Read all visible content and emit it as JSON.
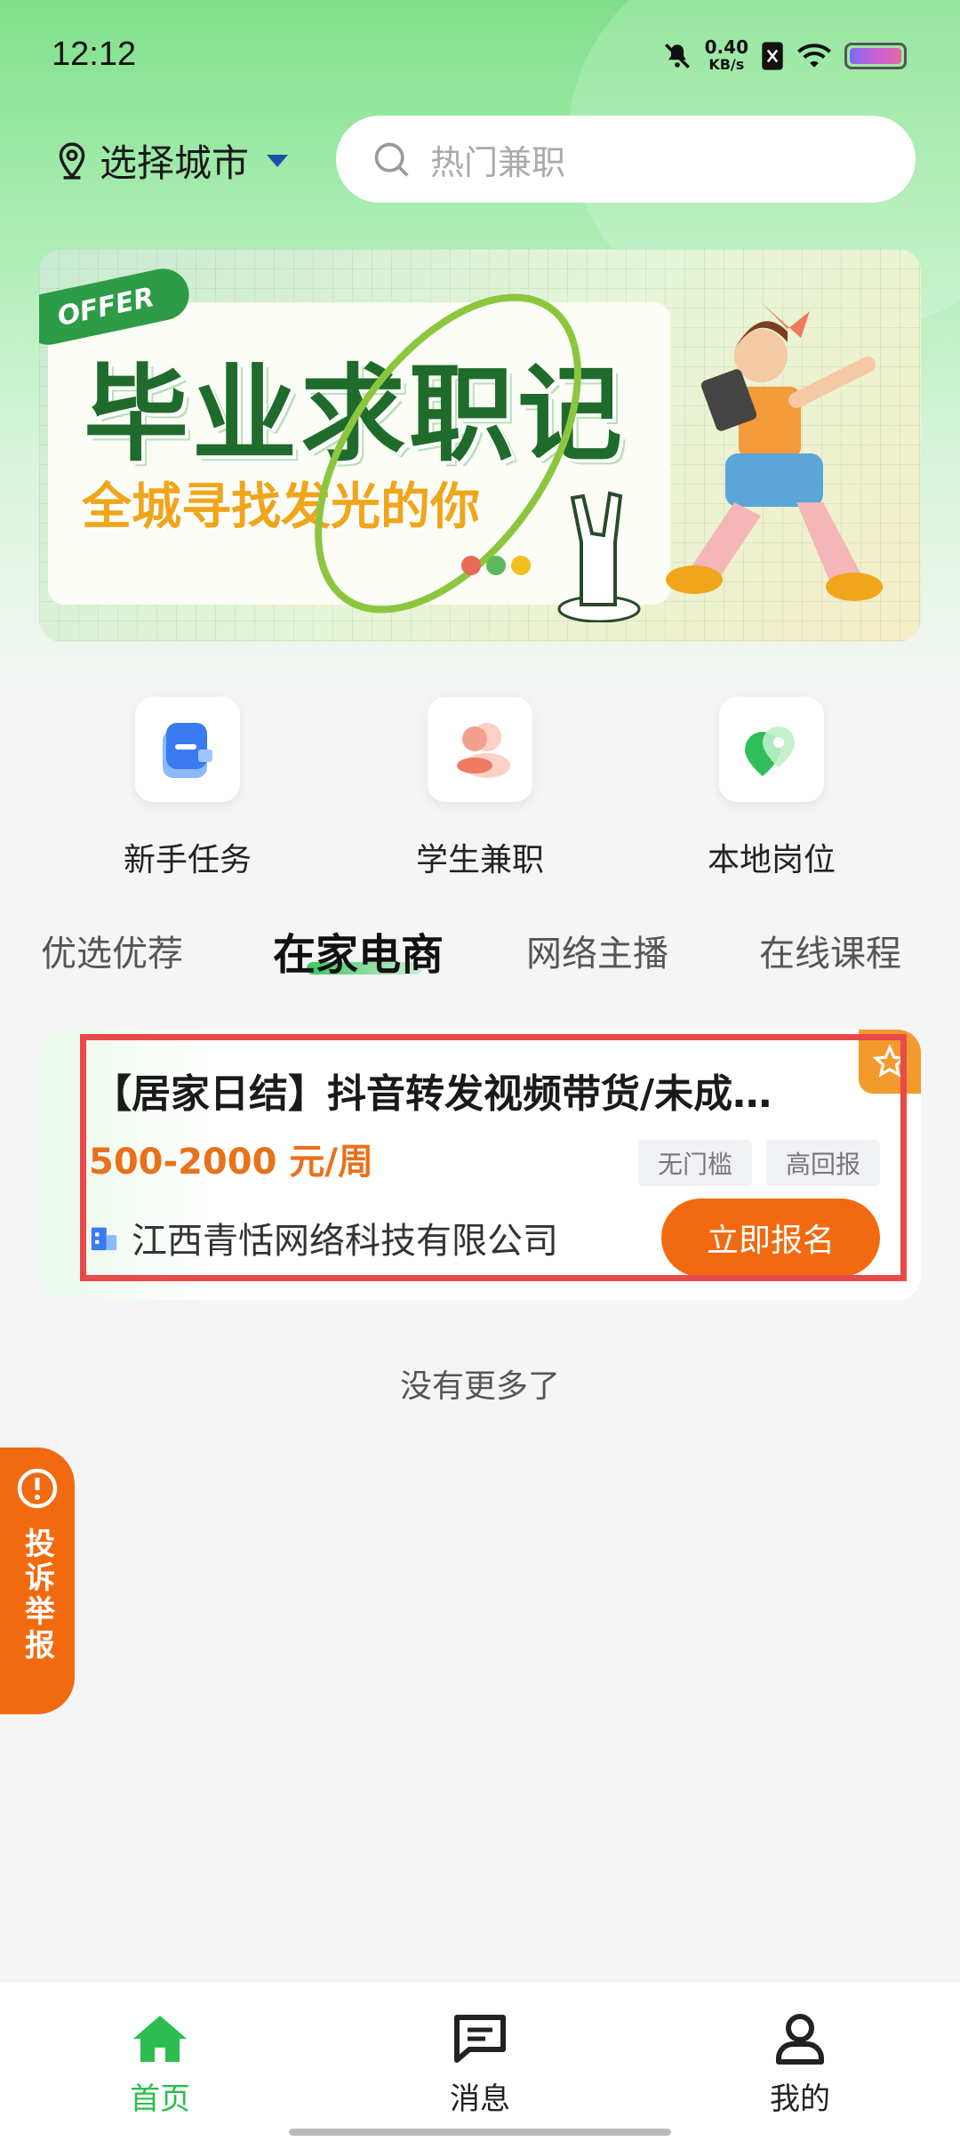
{
  "status_bar": {
    "time": "12:12",
    "net_speed": "0.40",
    "net_unit": "KB/s"
  },
  "header": {
    "city_label": "选择城市",
    "search_placeholder": "热门兼职"
  },
  "banner": {
    "offer_tag": "OFFER",
    "title": "毕业求职记",
    "subtitle": "全城寻找发光的你"
  },
  "shortcuts": [
    {
      "label": "新手任务",
      "icon": "task-icon"
    },
    {
      "label": "学生兼职",
      "icon": "student-icon"
    },
    {
      "label": "本地岗位",
      "icon": "location-icon"
    }
  ],
  "tabs": [
    {
      "label": "优选优荐",
      "active": false
    },
    {
      "label": "在家电商",
      "active": true
    },
    {
      "label": "网络主播",
      "active": false
    },
    {
      "label": "在线课程",
      "active": false
    }
  ],
  "job": {
    "title": "【居家日结】抖音转发视频带货/未成…",
    "salary": "500-2000 元/周",
    "tags": [
      "无门槛",
      "高回报"
    ],
    "company": "江西青恬网络科技有限公司",
    "apply_label": "立即报名"
  },
  "list_end": "没有更多了",
  "report_label": "投诉举报",
  "bottom_nav": [
    {
      "label": "首页",
      "icon": "home-icon",
      "active": true
    },
    {
      "label": "消息",
      "icon": "message-icon",
      "active": false
    },
    {
      "label": "我的",
      "icon": "profile-icon",
      "active": false
    }
  ],
  "colors": {
    "accent_green": "#2bbd4f",
    "accent_orange": "#f26a10",
    "highlight_red": "#e84a4a"
  }
}
